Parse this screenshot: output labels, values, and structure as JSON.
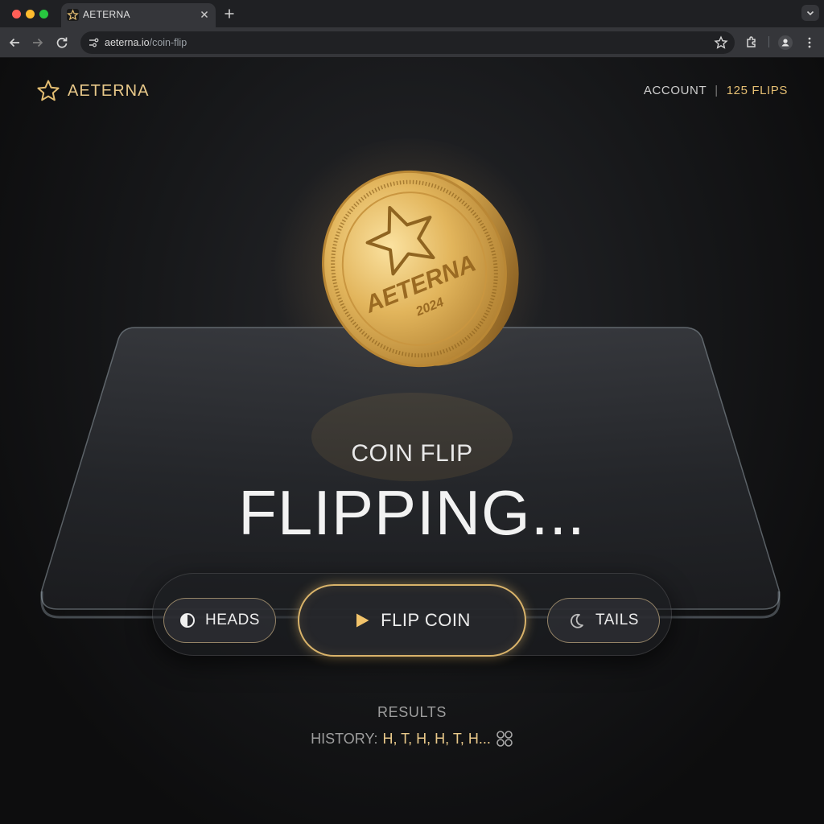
{
  "browser": {
    "tab_title": "AETERNA",
    "url_host": "aeterna.io",
    "url_path": "/coin-flip",
    "icons": [
      "close-icon",
      "plus-icon",
      "back-icon",
      "forward-icon",
      "reload-icon",
      "site-info-icon",
      "star-icon",
      "extensions-icon",
      "profile-icon",
      "more-icon",
      "chevron-down-icon"
    ]
  },
  "header": {
    "brand": "AETERNA",
    "account_label": "ACCOUNT",
    "divider": "|",
    "flips_label": "125 FLIPS"
  },
  "coin": {
    "emblem": "star",
    "inscription": "AETERNA",
    "year": "2024"
  },
  "game": {
    "title": "COIN FLIP",
    "status": "FLIPPING..."
  },
  "controls": {
    "heads_label": "HEADS",
    "flip_label": "FLIP COIN",
    "tails_label": "TAILS"
  },
  "results": {
    "label": "RESULTS",
    "history_label": "HISTORY:",
    "history_value": "H, T, H, H, T, H..."
  },
  "colors": {
    "accent_gold": "#e3bd72",
    "background": "#0d0d0e",
    "text": "#f2f2f2"
  }
}
